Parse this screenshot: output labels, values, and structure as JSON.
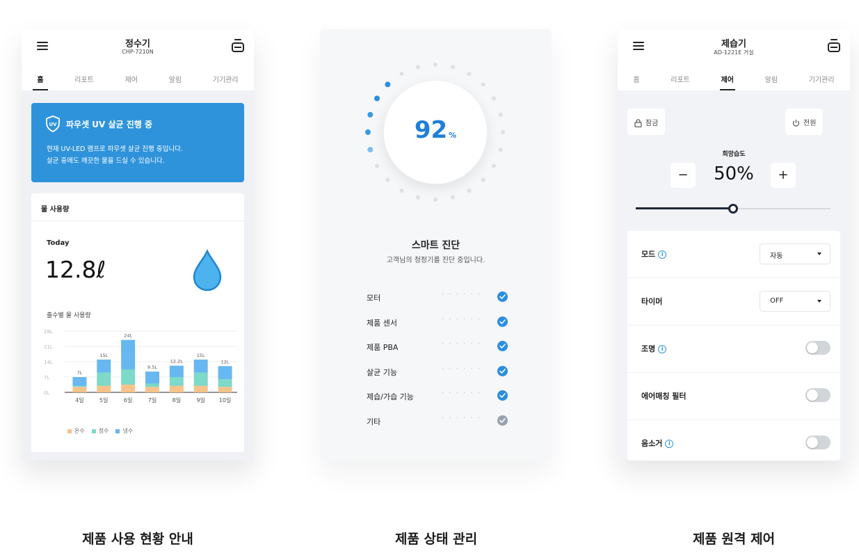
{
  "colors": {
    "accent": "#2f93dc",
    "warm": "#f7c38b",
    "purified": "#7dd9c8",
    "cold": "#67b8f0",
    "check_done": "#2b8ee0",
    "check_pending": "#9aa1ab"
  },
  "panel1": {
    "title": "정수기",
    "subtitle": "CHP-7210N",
    "tabs": [
      "홈",
      "리포트",
      "제어",
      "알림",
      "기기관리"
    ],
    "active_tab": 0,
    "banner": {
      "icon_label": "UV",
      "title": "파우셋 UV 살균 진행 중",
      "line1": "현재 UV-LED 램프로 파우셋 살균 진행 중입니다.",
      "line2": "살균 중에도 깨끗한 물을 드실 수 있습니다."
    },
    "usage": {
      "header": "물 사용량",
      "today_label": "Today",
      "today_value": "12.8ℓ",
      "floor_label": "출수별 물 사용량"
    },
    "caption": "제품 사용 현황 안내"
  },
  "chart_data": {
    "type": "bar",
    "stacked": true,
    "categories": [
      "4일",
      "5일",
      "6일",
      "7일",
      "8일",
      "9일",
      "10일"
    ],
    "totals_labels": [
      "7L",
      "15L",
      "24L",
      "9.5L",
      "12.2L",
      "15L",
      "12L"
    ],
    "series": [
      {
        "name": "온수",
        "values": [
          2.5,
          3,
          3.5,
          2.5,
          3,
          3,
          2.5
        ]
      },
      {
        "name": "정수",
        "values": [
          0.5,
          6,
          7,
          1.5,
          4,
          6,
          3.5
        ]
      },
      {
        "name": "냉수",
        "values": [
          4,
          6,
          13.5,
          5.5,
          5.2,
          6,
          6
        ]
      }
    ],
    "yticks": [
      "0L",
      "7L",
      "14L",
      "21L",
      "28L"
    ],
    "ylim": [
      0,
      28
    ]
  },
  "panel2": {
    "gauge_value": 92,
    "gauge_unit": "%",
    "title": "스마트 진단",
    "subtitle": "고객님의 청정기를 진단 중입니다.",
    "items": [
      {
        "label": "모터",
        "done": true
      },
      {
        "label": "제품 센서",
        "done": true
      },
      {
        "label": "제품 PBA",
        "done": true
      },
      {
        "label": "살균 기능",
        "done": true
      },
      {
        "label": "제습/가습 기능",
        "done": true
      },
      {
        "label": "기타",
        "done": false
      }
    ],
    "dots_text": "· · · · · ·",
    "caption": "제품 상태 관리"
  },
  "panel3": {
    "title": "제습기",
    "subtitle": "AD-1221E 거실",
    "tabs": [
      "홈",
      "리포트",
      "제어",
      "알림",
      "기기관리"
    ],
    "active_tab": 2,
    "lock_label": "잠금",
    "power_label": "전원",
    "humidity_label": "희망습도",
    "humidity_value": "50%",
    "humidity_level": 0.5,
    "minus_label": "−",
    "plus_label": "+",
    "mode": {
      "label": "모드",
      "value": "자동"
    },
    "timer": {
      "label": "타이머",
      "value": "OFF"
    },
    "light": {
      "label": "조명",
      "on": false
    },
    "filter": {
      "label": "에어매칭 필터",
      "on": false
    },
    "silent": {
      "label": "음소거",
      "on": false
    },
    "caption": "제품 원격 제어"
  }
}
